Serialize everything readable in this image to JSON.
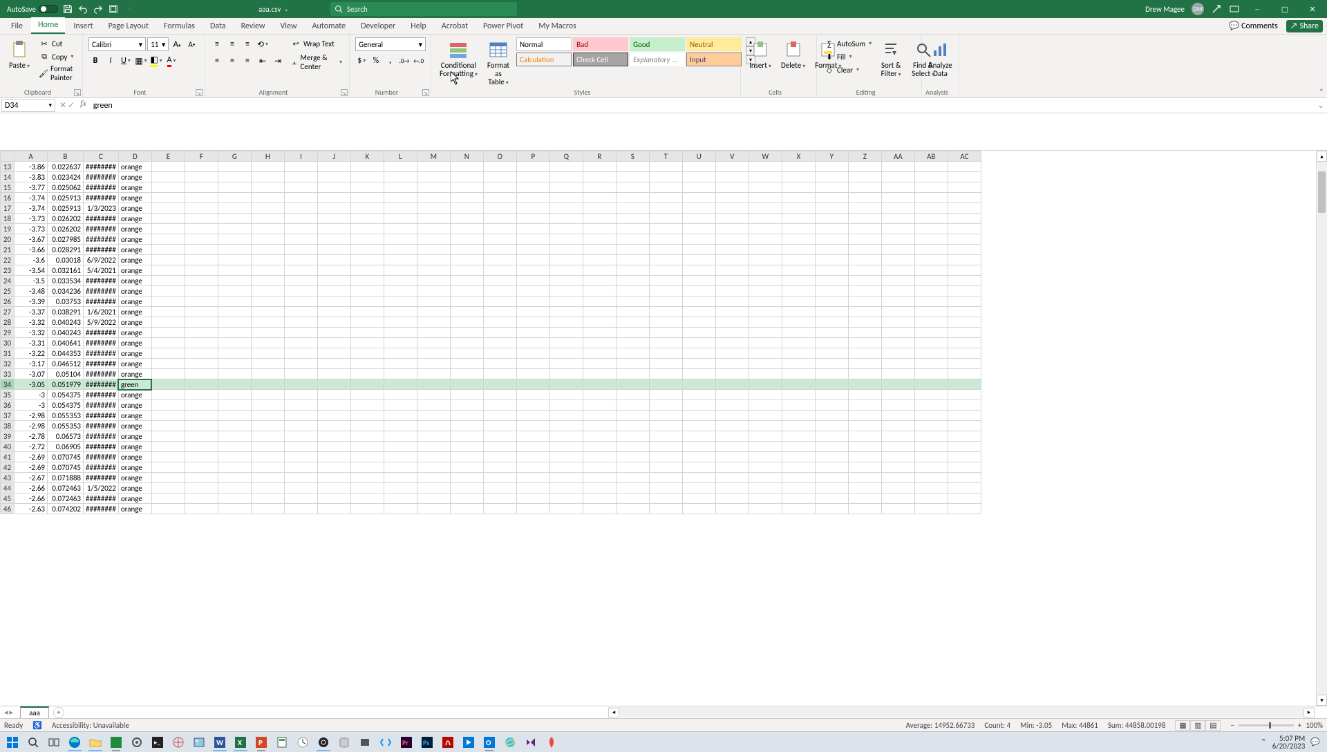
{
  "title": {
    "autosave": "AutoSave",
    "filename": "aaa.csv",
    "search_placeholder": "Search",
    "user_name": "Drew Magee",
    "user_initials": "DM"
  },
  "tabs": {
    "items": [
      "File",
      "Home",
      "Insert",
      "Page Layout",
      "Formulas",
      "Data",
      "Review",
      "View",
      "Automate",
      "Developer",
      "Help",
      "Acrobat",
      "Power Pivot",
      "My Macros"
    ],
    "active": "Home",
    "comments": "Comments",
    "share": "Share"
  },
  "ribbon": {
    "clipboard": {
      "paste": "Paste",
      "cut": "Cut",
      "copy": "Copy",
      "painter": "Format Painter",
      "label": "Clipboard"
    },
    "font": {
      "name": "Calibri",
      "size": "11",
      "label": "Font"
    },
    "alignment": {
      "wrap": "Wrap Text",
      "merge": "Merge & Center",
      "label": "Alignment"
    },
    "number": {
      "format": "General",
      "label": "Number"
    },
    "styles": {
      "cond": "Conditional Formatting",
      "table": "Format as Table",
      "label": "Styles",
      "cells": [
        {
          "t": "Normal",
          "bg": "#ffffff",
          "c": "#000",
          "bd": "#bfbfbf"
        },
        {
          "t": "Bad",
          "bg": "#ffc7ce",
          "c": "#9c0006",
          "bd": "#ffc7ce"
        },
        {
          "t": "Good",
          "bg": "#c6efce",
          "c": "#006100",
          "bd": "#c6efce"
        },
        {
          "t": "Neutral",
          "bg": "#ffeb9c",
          "c": "#9c5700",
          "bd": "#ffeb9c"
        },
        {
          "t": "Calculation",
          "bg": "#f2f2f2",
          "c": "#fa7d00",
          "bd": "#7f7f7f"
        },
        {
          "t": "Check Cell",
          "bg": "#a5a5a5",
          "c": "#ffffff",
          "bd": "#3f3f3f"
        },
        {
          "t": "Explanatory ...",
          "bg": "#ffffff",
          "c": "#7f7f7f",
          "bd": "#fff",
          "it": true
        },
        {
          "t": "Input",
          "bg": "#ffcc99",
          "c": "#3f3f76",
          "bd": "#7f7f7f"
        }
      ]
    },
    "cells": {
      "insert": "Insert",
      "delete": "Delete",
      "format": "Format",
      "label": "Cells"
    },
    "editing": {
      "sum": "AutoSum",
      "fill": "Fill",
      "clear": "Clear",
      "sort": "Sort & Filter",
      "find": "Find & Select",
      "label": "Editing"
    },
    "analysis": {
      "analyze": "Analyze Data",
      "label": "Analysis"
    }
  },
  "formula": {
    "name_box": "D34",
    "fx": "fx",
    "value": "green"
  },
  "grid": {
    "cols": [
      "A",
      "B",
      "C",
      "D",
      "E",
      "F",
      "G",
      "H",
      "I",
      "J",
      "K",
      "L",
      "M",
      "N",
      "O",
      "P",
      "Q",
      "R",
      "S",
      "T",
      "U",
      "V",
      "W",
      "X",
      "Y",
      "Z",
      "AA",
      "AB",
      "AC"
    ],
    "selected_col": "D",
    "selected_row": 34,
    "rows": [
      {
        "n": 13,
        "a": "-3.86",
        "b": "0.022637",
        "c": "########",
        "d": "orange"
      },
      {
        "n": 14,
        "a": "-3.83",
        "b": "0.023424",
        "c": "########",
        "d": "orange"
      },
      {
        "n": 15,
        "a": "-3.77",
        "b": "0.025062",
        "c": "########",
        "d": "orange"
      },
      {
        "n": 16,
        "a": "-3.74",
        "b": "0.025913",
        "c": "########",
        "d": "orange"
      },
      {
        "n": 17,
        "a": "-3.74",
        "b": "0.025913",
        "c": "1/3/2023",
        "d": "orange"
      },
      {
        "n": 18,
        "a": "-3.73",
        "b": "0.026202",
        "c": "########",
        "d": "orange"
      },
      {
        "n": 19,
        "a": "-3.73",
        "b": "0.026202",
        "c": "########",
        "d": "orange"
      },
      {
        "n": 20,
        "a": "-3.67",
        "b": "0.027985",
        "c": "########",
        "d": "orange"
      },
      {
        "n": 21,
        "a": "-3.66",
        "b": "0.028291",
        "c": "########",
        "d": "orange"
      },
      {
        "n": 22,
        "a": "-3.6",
        "b": "0.03018",
        "c": "6/9/2022",
        "d": "orange"
      },
      {
        "n": 23,
        "a": "-3.54",
        "b": "0.032161",
        "c": "5/4/2021",
        "d": "orange"
      },
      {
        "n": 24,
        "a": "-3.5",
        "b": "0.033534",
        "c": "########",
        "d": "orange"
      },
      {
        "n": 25,
        "a": "-3.48",
        "b": "0.034236",
        "c": "########",
        "d": "orange"
      },
      {
        "n": 26,
        "a": "-3.39",
        "b": "0.03753",
        "c": "########",
        "d": "orange"
      },
      {
        "n": 27,
        "a": "-3.37",
        "b": "0.038291",
        "c": "1/6/2021",
        "d": "orange"
      },
      {
        "n": 28,
        "a": "-3.32",
        "b": "0.040243",
        "c": "5/9/2022",
        "d": "orange"
      },
      {
        "n": 29,
        "a": "-3.32",
        "b": "0.040243",
        "c": "########",
        "d": "orange"
      },
      {
        "n": 30,
        "a": "-3.31",
        "b": "0.040641",
        "c": "########",
        "d": "orange"
      },
      {
        "n": 31,
        "a": "-3.22",
        "b": "0.044353",
        "c": "########",
        "d": "orange"
      },
      {
        "n": 32,
        "a": "-3.17",
        "b": "0.046512",
        "c": "########",
        "d": "orange"
      },
      {
        "n": 33,
        "a": "-3.07",
        "b": "0.05104",
        "c": "########",
        "d": "orange"
      },
      {
        "n": 34,
        "a": "-3.05",
        "b": "0.051979",
        "c": "########",
        "d": "green"
      },
      {
        "n": 35,
        "a": "-3",
        "b": "0.054375",
        "c": "########",
        "d": "orange"
      },
      {
        "n": 36,
        "a": "-3",
        "b": "0.054375",
        "c": "########",
        "d": "orange"
      },
      {
        "n": 37,
        "a": "-2.98",
        "b": "0.055353",
        "c": "########",
        "d": "orange"
      },
      {
        "n": 38,
        "a": "-2.98",
        "b": "0.055353",
        "c": "########",
        "d": "orange"
      },
      {
        "n": 39,
        "a": "-2.78",
        "b": "0.06573",
        "c": "########",
        "d": "orange"
      },
      {
        "n": 40,
        "a": "-2.72",
        "b": "0.06905",
        "c": "########",
        "d": "orange"
      },
      {
        "n": 41,
        "a": "-2.69",
        "b": "0.070745",
        "c": "########",
        "d": "orange"
      },
      {
        "n": 42,
        "a": "-2.69",
        "b": "0.070745",
        "c": "########",
        "d": "orange"
      },
      {
        "n": 43,
        "a": "-2.67",
        "b": "0.071888",
        "c": "########",
        "d": "orange"
      },
      {
        "n": 44,
        "a": "-2.66",
        "b": "0.072463",
        "c": "1/5/2022",
        "d": "orange"
      },
      {
        "n": 45,
        "a": "-2.66",
        "b": "0.072463",
        "c": "########",
        "d": "orange"
      },
      {
        "n": 46,
        "a": "-2.63",
        "b": "0.074202",
        "c": "########",
        "d": "orange"
      }
    ]
  },
  "sheet": {
    "name": "aaa"
  },
  "status": {
    "ready": "Ready",
    "access": "Accessibility: Unavailable",
    "avg": "Average: 14952.66733",
    "count": "Count: 4",
    "min": "Min: -3.05",
    "max": "Max: 44861",
    "sum": "Sum: 44858.00198",
    "zoom": "100%"
  },
  "tray": {
    "time": "5:07 PM",
    "date": "6/20/2023"
  }
}
